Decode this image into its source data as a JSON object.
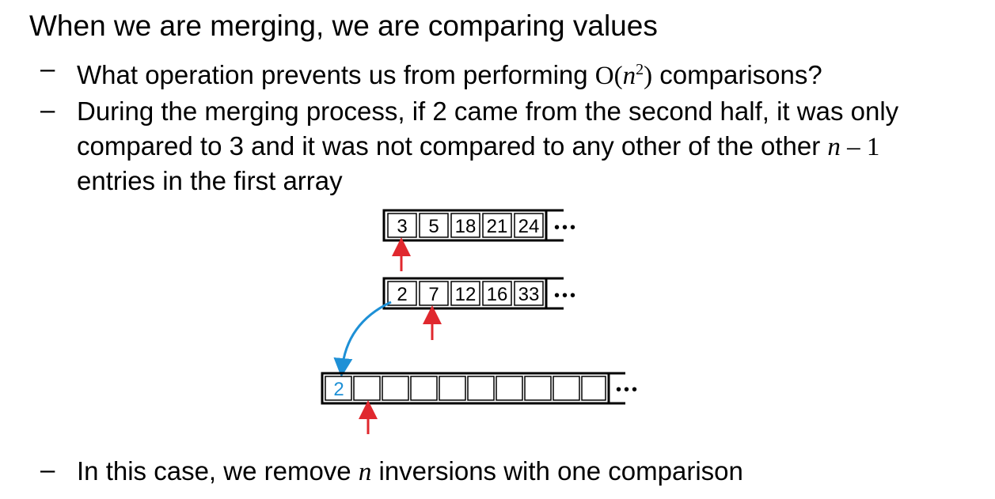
{
  "title": "When we are merging, we are comparing values",
  "bullets": {
    "b1": {
      "dash": "–",
      "pre": "What operation prevents us from performing ",
      "bigO": "O(",
      "n": "n",
      "sup": "2",
      "close": ")",
      "post": " comparisons?"
    },
    "b2": {
      "dash": "–",
      "line1": "During the merging process, if 2 came from the second half, it was only",
      "line2_pre": "compared to 3 and it was not compared to any other of the other ",
      "n": "n",
      "minus_one": " – 1",
      "line3": "entries in the first array"
    },
    "b3": {
      "dash": "–",
      "pre": "In this case, we remove ",
      "n": "n",
      "post": " inversions with one comparison"
    }
  },
  "diagram": {
    "first_array": [
      "3",
      "5",
      "18",
      "21",
      "24"
    ],
    "second_array": [
      "2",
      "7",
      "12",
      "16",
      "33"
    ],
    "merged_array": [
      "2"
    ],
    "merged_array_cells": 10,
    "ellipsis": "•••",
    "colors": {
      "pointer": "#e0282e",
      "moved": "#1e90d6",
      "outline": "#000000"
    }
  }
}
